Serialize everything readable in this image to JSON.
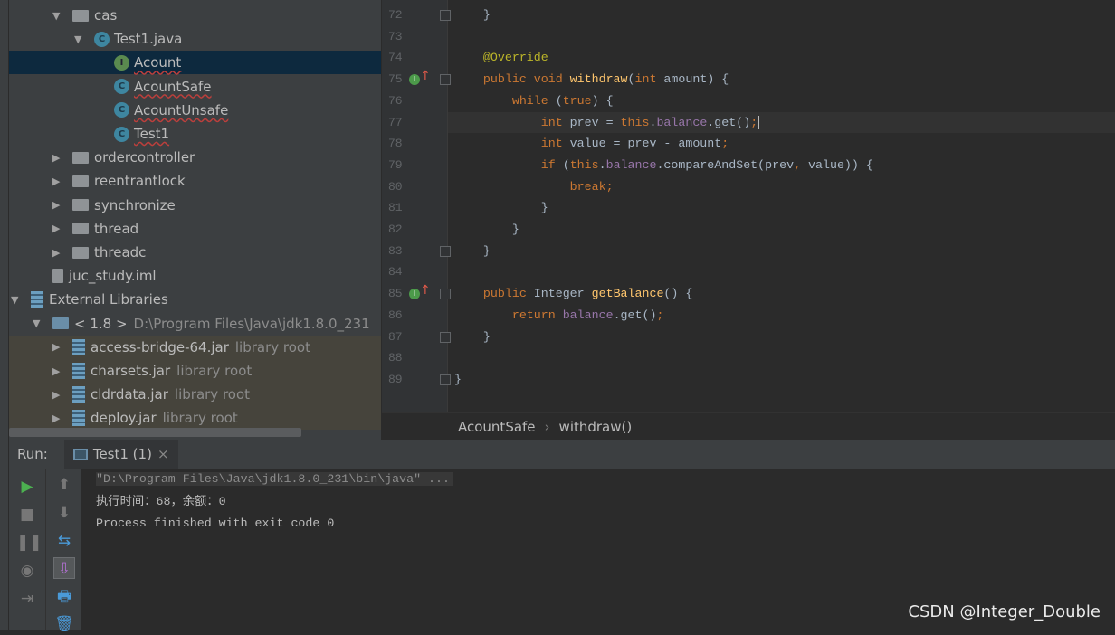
{
  "tree": {
    "items": [
      {
        "label": "cas",
        "type": "folder",
        "indent": 48,
        "expanded": true
      },
      {
        "label": "Test1.java",
        "type": "class-run",
        "indent": 72,
        "expanded": true
      },
      {
        "label": "Acount",
        "type": "interface",
        "indent": 116,
        "selected": true,
        "error": true
      },
      {
        "label": "AcountSafe",
        "type": "class",
        "indent": 116,
        "error": true
      },
      {
        "label": "AcountUnsafe",
        "type": "class",
        "indent": 116,
        "error": true
      },
      {
        "label": "Test1",
        "type": "class-run",
        "indent": 116,
        "error": true
      },
      {
        "label": "ordercontroller",
        "type": "folder",
        "indent": 48,
        "expanded": false
      },
      {
        "label": "reentrantlock",
        "type": "folder",
        "indent": 48,
        "expanded": false
      },
      {
        "label": "synchronize",
        "type": "folder",
        "indent": 48,
        "expanded": false
      },
      {
        "label": "thread",
        "type": "folder",
        "indent": 48,
        "expanded": false
      },
      {
        "label": "threadc",
        "type": "folder",
        "indent": 48,
        "expanded": false
      },
      {
        "label": "juc_study.iml",
        "type": "file",
        "indent": 48
      },
      {
        "label": "External Libraries",
        "type": "libs",
        "indent": 2,
        "expanded": true
      },
      {
        "label": "< 1.8 >",
        "hint": "D:\\Program Files\\Java\\jdk1.8.0_231",
        "type": "jdk",
        "indent": 26,
        "expanded": true
      },
      {
        "label": "access-bridge-64.jar",
        "hint": "library root",
        "type": "jar",
        "indent": 48,
        "expanded": false,
        "lib": true
      },
      {
        "label": "charsets.jar",
        "hint": "library root",
        "type": "jar",
        "indent": 48,
        "expanded": false,
        "lib": true
      },
      {
        "label": "cldrdata.jar",
        "hint": "library root",
        "type": "jar",
        "indent": 48,
        "expanded": false,
        "lib": true
      },
      {
        "label": "deploy.jar",
        "hint": "library root",
        "type": "jar",
        "indent": 48,
        "expanded": false,
        "lib": true
      }
    ]
  },
  "editor": {
    "current_line": 77,
    "lines": [
      {
        "n": "72",
        "fold": true,
        "t": [
          [
            "",
            "    }"
          ]
        ]
      },
      {
        "n": "73",
        "t": []
      },
      {
        "n": "74",
        "t": [
          [
            "an",
            "    @Override"
          ]
        ]
      },
      {
        "n": "75",
        "fold": true,
        "mark": true,
        "t": [
          [
            "kw",
            "    public void "
          ],
          [
            "mt",
            "withdraw"
          ],
          [
            "",
            "("
          ],
          [
            "kw",
            "int "
          ],
          [
            "",
            "amount) {"
          ]
        ]
      },
      {
        "n": "76",
        "t": [
          [
            "kw",
            "        while "
          ],
          [
            "",
            "("
          ],
          [
            "kw",
            "true"
          ],
          [
            "",
            ") {"
          ]
        ]
      },
      {
        "n": "77",
        "t": [
          [
            "kw",
            "            int "
          ],
          [
            "",
            "prev = "
          ],
          [
            "kw",
            "this"
          ],
          [
            "",
            "."
          ],
          [
            "fd",
            "balance"
          ],
          [
            "",
            ".get()"
          ],
          [
            "kw",
            ";"
          ]
        ]
      },
      {
        "n": "78",
        "t": [
          [
            "kw",
            "            int "
          ],
          [
            "",
            "value = prev - amount"
          ],
          [
            "kw",
            ";"
          ]
        ]
      },
      {
        "n": "79",
        "t": [
          [
            "kw",
            "            if "
          ],
          [
            "",
            "("
          ],
          [
            "kw",
            "this"
          ],
          [
            "",
            "."
          ],
          [
            "fd",
            "balance"
          ],
          [
            "",
            ".compareAndSet(prev"
          ],
          [
            "kw",
            ", "
          ],
          [
            "",
            "value)) {"
          ]
        ]
      },
      {
        "n": "80",
        "t": [
          [
            "kw",
            "                break;"
          ]
        ]
      },
      {
        "n": "81",
        "t": [
          [
            "",
            "            }"
          ]
        ]
      },
      {
        "n": "82",
        "t": [
          [
            "",
            "        }"
          ]
        ]
      },
      {
        "n": "83",
        "fold": true,
        "t": [
          [
            "",
            "    }"
          ]
        ]
      },
      {
        "n": "84",
        "t": []
      },
      {
        "n": "85",
        "fold": true,
        "mark": true,
        "t": [
          [
            "kw",
            "    public "
          ],
          [
            "",
            "Integer "
          ],
          [
            "mt",
            "getBalance"
          ],
          [
            "",
            "() {"
          ]
        ]
      },
      {
        "n": "86",
        "t": [
          [
            "kw",
            "        return "
          ],
          [
            "fd",
            "balance"
          ],
          [
            "",
            ".get()"
          ],
          [
            "kw",
            ";"
          ]
        ]
      },
      {
        "n": "87",
        "fold": true,
        "t": [
          [
            "",
            "    }"
          ]
        ]
      },
      {
        "n": "88",
        "t": []
      },
      {
        "n": "89",
        "fold": true,
        "t": [
          [
            "",
            "}"
          ]
        ]
      }
    ]
  },
  "breadcrumb": {
    "class": "AcountSafe",
    "sep": "›",
    "method": "withdraw()"
  },
  "run": {
    "label": "Run:",
    "tab": "Test1 (1)",
    "close": "×",
    "console": [
      "\"D:\\Program Files\\Java\\jdk1.8.0_231\\bin\\java\" ...",
      "执行时间：68，余额：0",
      "",
      "Process finished with exit code 0"
    ]
  },
  "watermark": "CSDN @Integer_Double"
}
